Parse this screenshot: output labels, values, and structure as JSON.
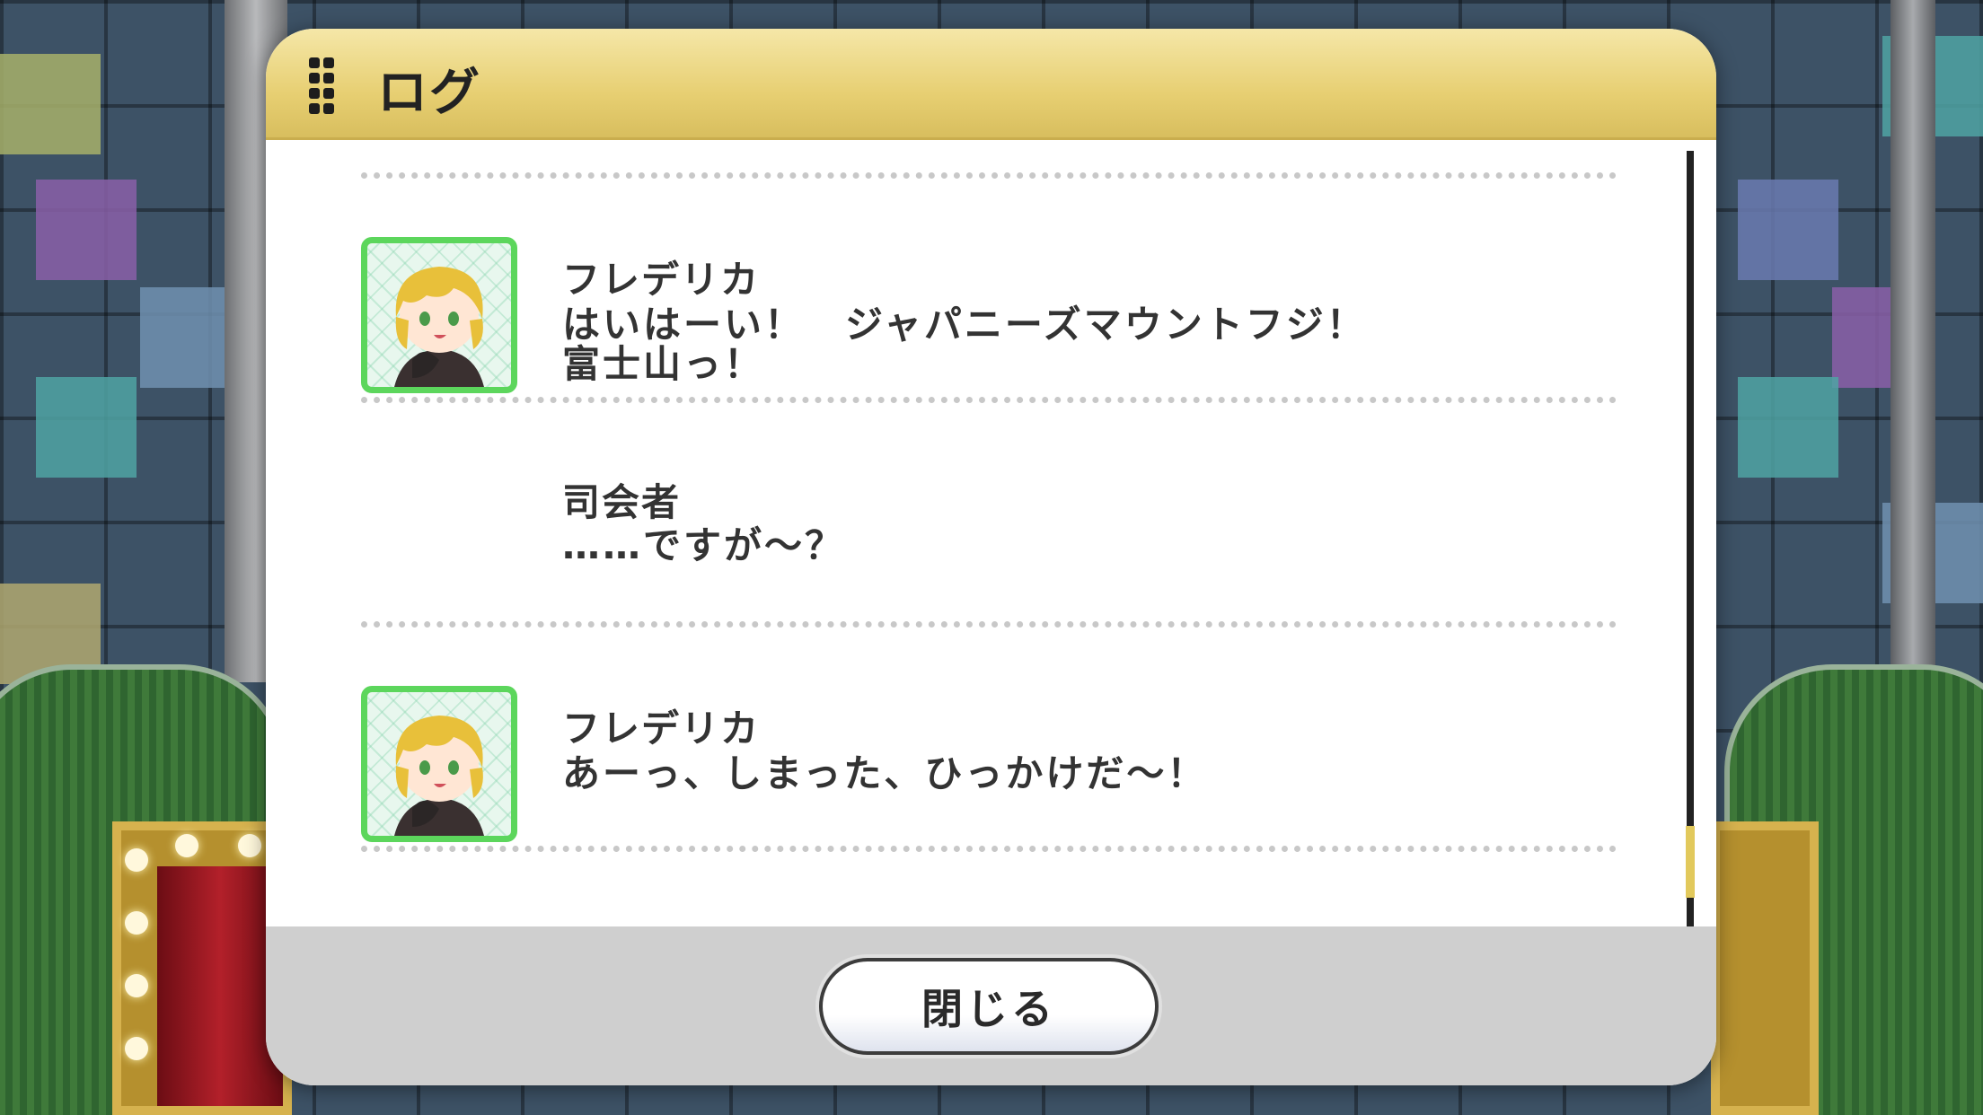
{
  "dialog": {
    "title": "ログ",
    "icon": "grip-icon",
    "close_label": "閉じる"
  },
  "log": {
    "entries": [
      {
        "speaker": "フレデリカ",
        "has_avatar": true,
        "message": "はいはーい！　ジャパニーズマウントフジ！\n富士山っ！"
      },
      {
        "speaker": "司会者",
        "has_avatar": false,
        "message": "……ですが～？"
      },
      {
        "speaker": "フレデリカ",
        "has_avatar": true,
        "message": "あーっ、しまった、ひっかけだ～！"
      }
    ]
  },
  "colors": {
    "header": "#e7cf72",
    "avatar_border": "#5cd65c",
    "footer": "#cfcfcf",
    "scroll_thumb": "#e2c95c"
  }
}
